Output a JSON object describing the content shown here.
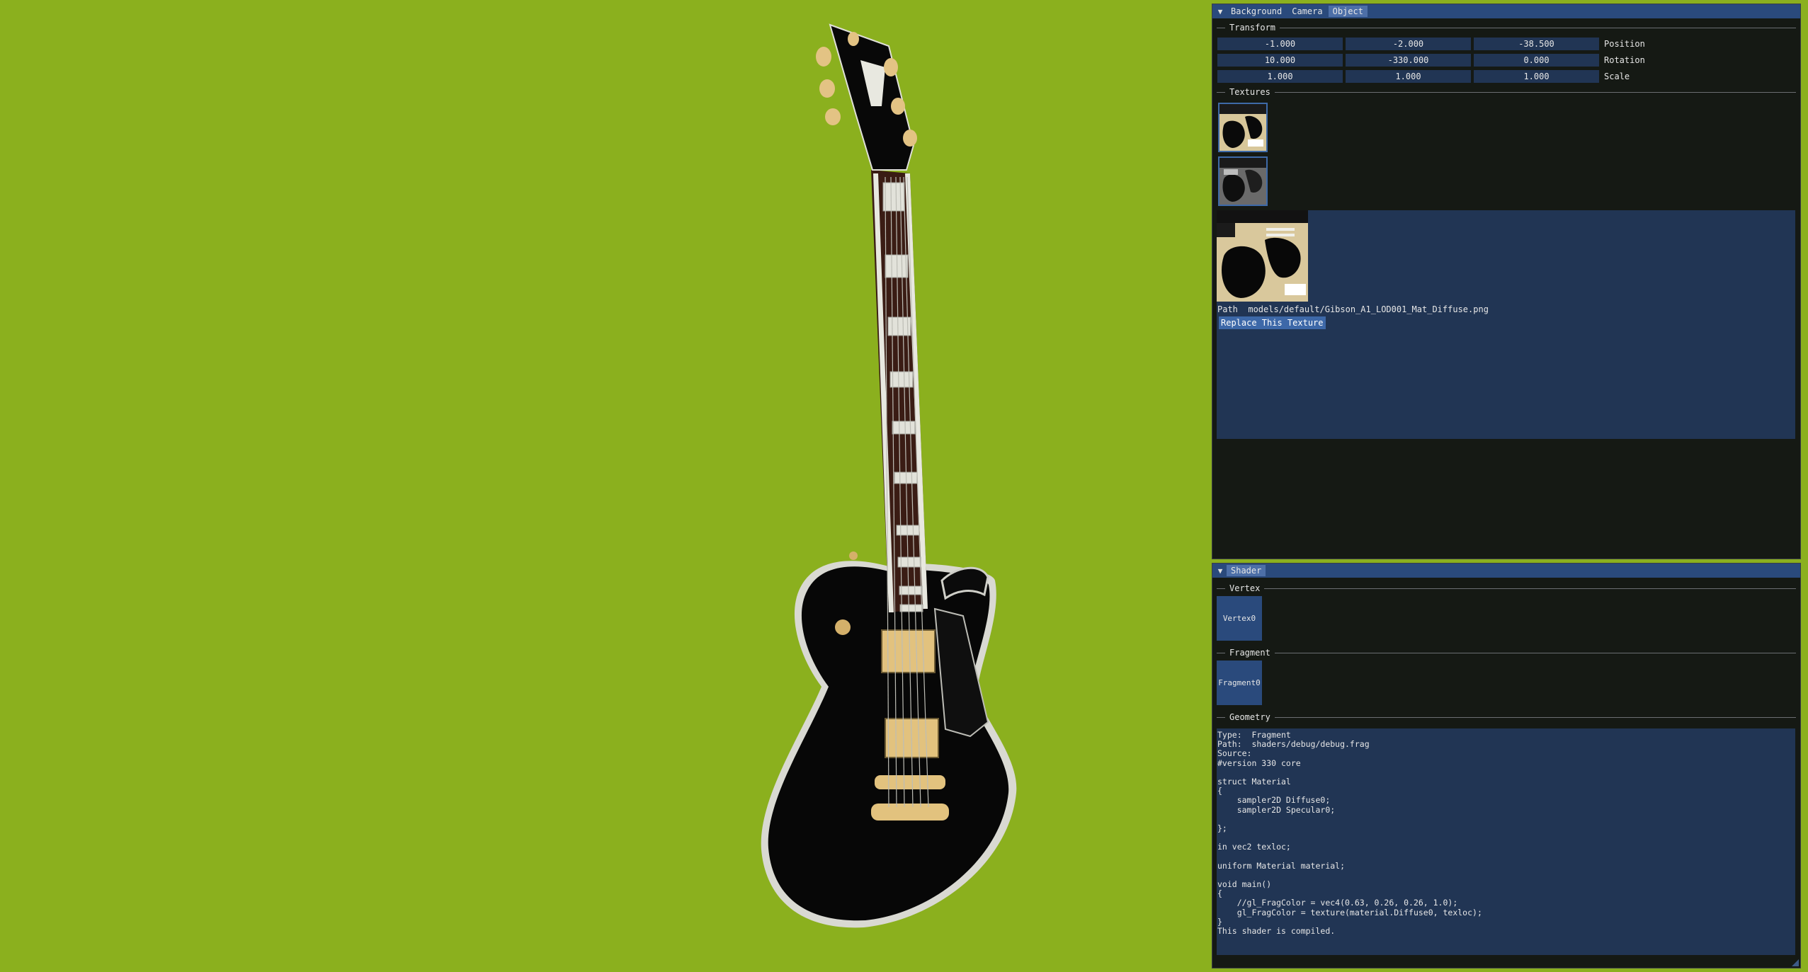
{
  "object_panel": {
    "tabs": [
      "Background",
      "Camera",
      "Object"
    ],
    "active_tab": "Object",
    "transform": {
      "title": "Transform",
      "rows": [
        {
          "values": [
            "-1.000",
            "-2.000",
            "-38.500"
          ],
          "label": "Position"
        },
        {
          "values": [
            "10.000",
            "-330.000",
            "0.000"
          ],
          "label": "Rotation"
        },
        {
          "values": [
            "1.000",
            "1.000",
            "1.000"
          ],
          "label": "Scale"
        }
      ]
    },
    "textures": {
      "title": "Textures",
      "path_label": "Path",
      "path_value": "models/default/Gibson_A1_LOD001_Mat_Diffuse.png",
      "replace_button": "Replace This Texture"
    }
  },
  "shader_panel": {
    "tab": "Shader",
    "vertex": {
      "title": "Vertex",
      "button": "Vertex0"
    },
    "fragment": {
      "title": "Fragment",
      "button": "Fragment0"
    },
    "geometry": {
      "title": "Geometry",
      "lines": [
        "Type:  Fragment",
        "Path:  shaders/debug/debug.frag",
        "Source:",
        "#version 330 core",
        "",
        "struct Material",
        "{",
        "    sampler2D Diffuse0;",
        "    sampler2D Specular0;",
        "",
        "};",
        "",
        "in vec2 texloc;",
        "",
        "uniform Material material;",
        "",
        "void main()",
        "{",
        "    //gl_FragColor = vec4(0.63, 0.26, 0.26, 1.0);",
        "    gl_FragColor = texture(material.Diffuse0, texloc);",
        "}",
        "This shader is compiled."
      ]
    }
  },
  "colors": {
    "viewport_background": "#8bb01e",
    "panel_background": "#151914",
    "title_bar": "#2a4a7c",
    "field_background": "#213554",
    "button": "#3d68a8"
  }
}
